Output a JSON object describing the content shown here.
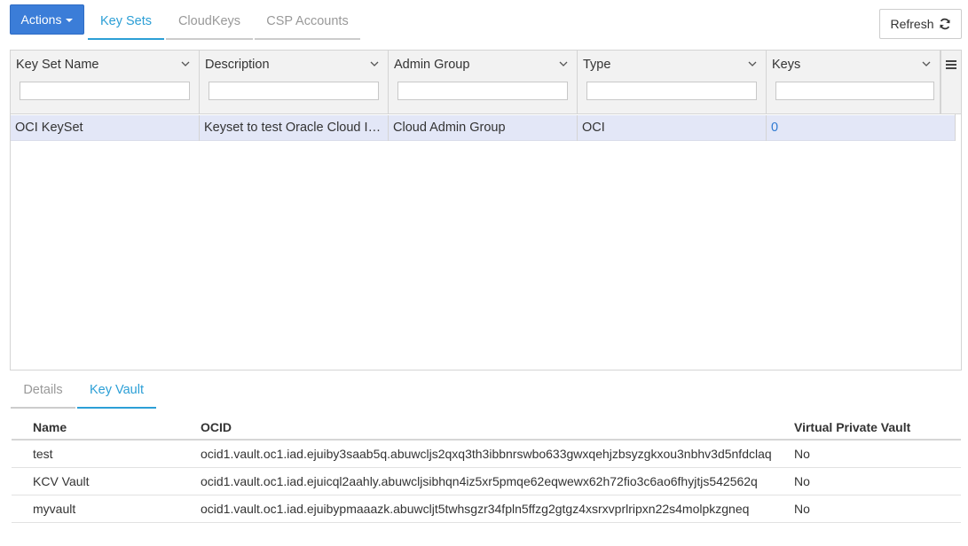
{
  "toolbar": {
    "actions_label": "Actions",
    "refresh_label": "Refresh"
  },
  "top_tabs": [
    {
      "label": "Key Sets",
      "active": true
    },
    {
      "label": "CloudKeys",
      "active": false
    },
    {
      "label": "CSP Accounts",
      "active": false
    }
  ],
  "grid": {
    "columns": [
      {
        "label": "Key Set Name",
        "filter_value": ""
      },
      {
        "label": "Description",
        "filter_value": ""
      },
      {
        "label": "Admin Group",
        "filter_value": ""
      },
      {
        "label": "Type",
        "filter_value": ""
      },
      {
        "label": "Keys",
        "filter_value": ""
      }
    ],
    "rows": [
      {
        "name": "OCI KeySet",
        "description": "Keyset to test Oracle Cloud Integration",
        "admin_group": "Cloud Admin Group",
        "type": "OCI",
        "keys": "0"
      }
    ]
  },
  "bottom_tabs": [
    {
      "label": "Details",
      "active": false
    },
    {
      "label": "Key Vault",
      "active": true
    }
  ],
  "vault_table": {
    "headers": {
      "name": "Name",
      "ocid": "OCID",
      "vpv": "Virtual Private Vault"
    },
    "rows": [
      {
        "name": "test",
        "ocid": "ocid1.vault.oc1.iad.ejuiby3saab5q.abuwcljs2qxq3th3ibbnrswbo633gwxqehjzbsyzgkxou3nbhv3d5nfdclaq",
        "vpv": "No"
      },
      {
        "name": "KCV Vault",
        "ocid": "ocid1.vault.oc1.iad.ejuicql2aahly.abuwcljsibhqn4iz5xr5pmqe62eqwewx62h72fio3c6ao6fhyjtjs542562q",
        "vpv": "No"
      },
      {
        "name": "myvault",
        "ocid": "ocid1.vault.oc1.iad.ejuibypmaaazk.abuwcljt5twhsgzr34fpln5ffzg2gtgz4xsrxvprlripxn22s4molpkzgneq",
        "vpv": "No"
      }
    ]
  },
  "colors": {
    "accent": "#2c9fd6",
    "primary_button": "#3b7dd8",
    "selected_row": "#e3e7f7",
    "link": "#2f7ad1"
  }
}
